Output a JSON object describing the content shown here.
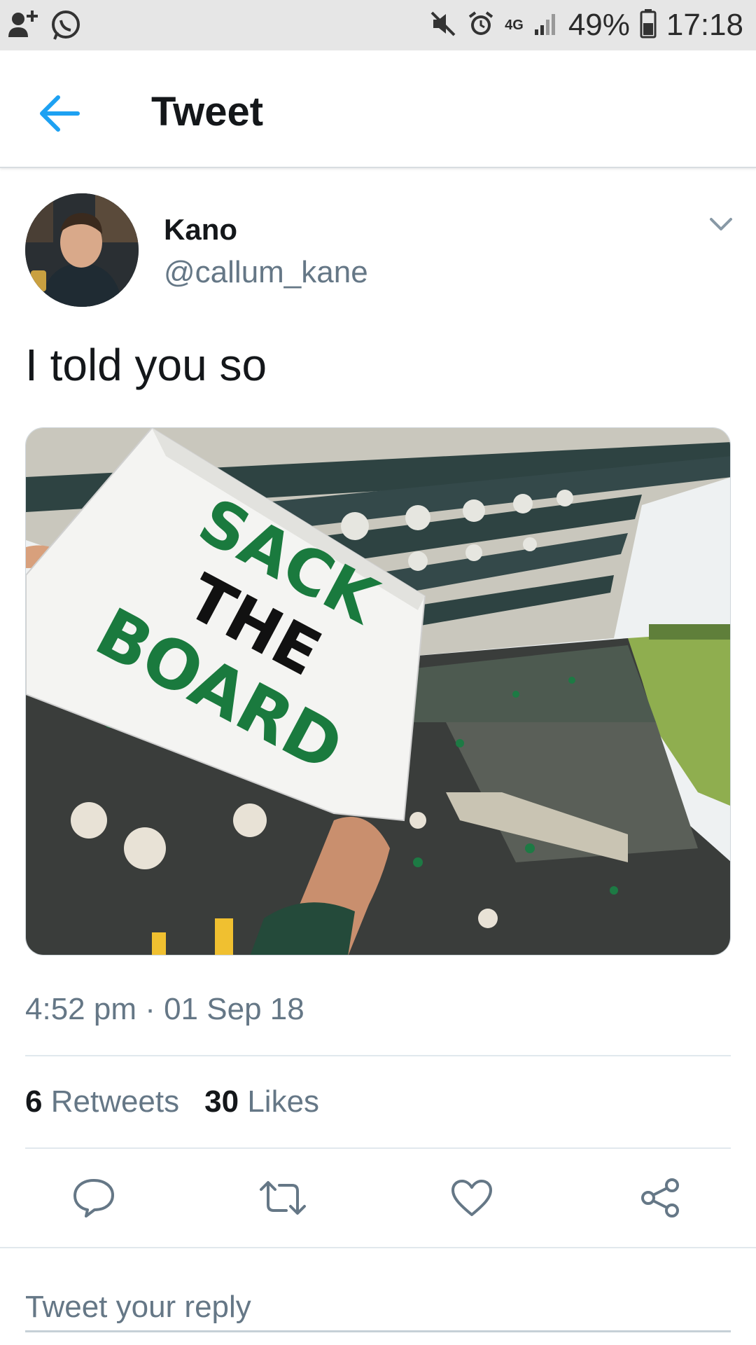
{
  "status_bar": {
    "network": "4G",
    "battery": "49%",
    "time": "17:18"
  },
  "app_bar": {
    "title": "Tweet"
  },
  "tweet": {
    "author_name": "Kano",
    "author_handle": "@callum_kane",
    "text": "I told you so",
    "timestamp": "4:52 pm · 01 Sep 18",
    "retweets_count": "6",
    "retweets_label": "Retweets",
    "likes_count": "30",
    "likes_label": "Likes",
    "media_sign": {
      "line1": "SACK",
      "line2": "THE",
      "line3": "BOARD"
    }
  },
  "reply": {
    "placeholder": "Tweet your reply"
  },
  "colors": {
    "accent": "#1da1f2",
    "secondary_text": "#657786",
    "sign_green": "#1a7a3e"
  }
}
